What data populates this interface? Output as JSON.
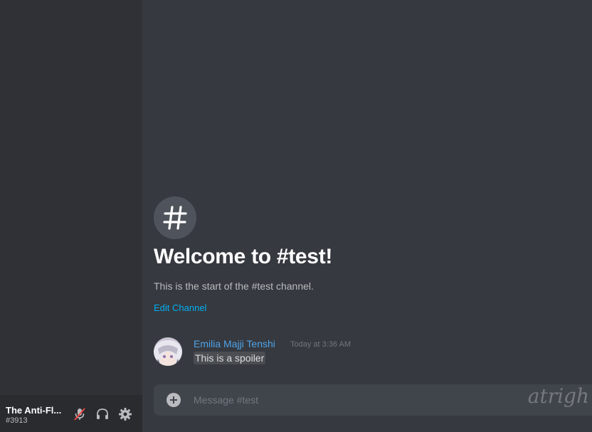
{
  "user_panel": {
    "name": "The Anti-Fl...",
    "tag": "#3913",
    "icons": [
      "mic-muted-icon",
      "headphones-icon",
      "gear-icon"
    ]
  },
  "channel_intro": {
    "icon": "hashtag-icon",
    "title": "Welcome to #test!",
    "subtitle": "This is the start of the #test channel.",
    "edit_label": "Edit Channel"
  },
  "messages": [
    {
      "author": "Emilia Majji Tenshi",
      "timestamp": "Today at 3:36 AM",
      "content": "This is a spoiler"
    }
  ],
  "composer": {
    "placeholder": "Message #test"
  },
  "watermark": "atrigh",
  "colors": {
    "sidebar": "#2f3136",
    "main": "#36393f",
    "accent_link": "#00b0f4",
    "author": "#4ea3e8",
    "muted_red": "#f04747"
  }
}
